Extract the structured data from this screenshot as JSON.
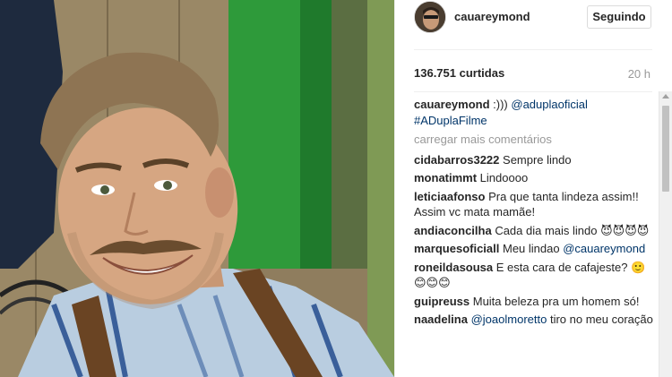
{
  "header": {
    "username": "cauareymond",
    "follow_label": "Seguindo"
  },
  "stats": {
    "likes": "136.751 curtidas",
    "time": "20 h"
  },
  "caption": {
    "user": "cauareymond",
    "text_prefix": " :)))  ",
    "mention": "@aduplaoficial",
    "hashtag": "#ADuplaFilme"
  },
  "load_more_label": "carregar mais comentários",
  "comments": [
    {
      "user": "cidabarros3222",
      "text": " Sempre lindo",
      "mention": ""
    },
    {
      "user": "monatimmt",
      "text": " Lindoooo",
      "mention": ""
    },
    {
      "user": "leticiaafonso",
      "text": " Pra que tanta lindeza assim!! Assim vc mata mamãe!",
      "mention": ""
    },
    {
      "user": "andiaconcilha",
      "text": " Cada dia mais lindo 😈😈😈😈",
      "mention": ""
    },
    {
      "user": "marquesoficiall",
      "text": " Meu lindao ",
      "mention": "@cauareymond"
    },
    {
      "user": "roneildasousa",
      "text": " E esta cara de cafajeste? 🙂😊😊😊",
      "mention": ""
    },
    {
      "user": "guipreuss",
      "text": " Muita beleza pra um homem só!",
      "mention": ""
    },
    {
      "user": "naadelina",
      "text": " tiro no meu coração",
      "mention": "@joaolmoretto"
    }
  ],
  "colors": {
    "mention": "#003569",
    "muted": "#999999",
    "photo_green": "#2e9a3a"
  }
}
